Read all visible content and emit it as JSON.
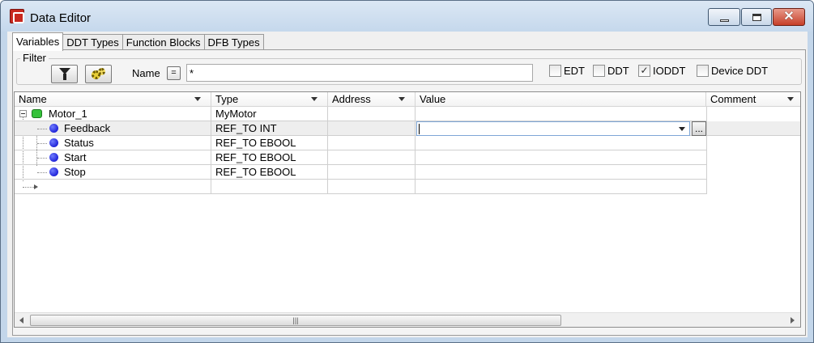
{
  "window": {
    "title": "Data Editor"
  },
  "tabs": [
    {
      "label": "Variables",
      "active": true
    },
    {
      "label": "DDT Types",
      "active": false
    },
    {
      "label": "Function Blocks",
      "active": false
    },
    {
      "label": "DFB Types",
      "active": false
    }
  ],
  "filter": {
    "group_label": "Filter",
    "name_label": "Name",
    "operator_label": "=",
    "name_value": "*",
    "checkboxes": [
      {
        "label": "EDT",
        "checked": false,
        "mark": ""
      },
      {
        "label": "DDT",
        "checked": false,
        "mark": ""
      },
      {
        "label": "IODDT",
        "checked": true,
        "mark": "✓"
      },
      {
        "label": "Device DDT",
        "checked": false,
        "mark": ""
      }
    ]
  },
  "table": {
    "columns": [
      "Name",
      "Type",
      "Address",
      "Value",
      "Comment"
    ],
    "rows": [
      {
        "name": "Motor_1",
        "type": "MyMotor",
        "address": "",
        "value": "",
        "comment": ""
      },
      {
        "name": "Feedback",
        "type": "REF_TO INT",
        "address": "",
        "value": "",
        "comment": ""
      },
      {
        "name": "Status",
        "type": "REF_TO EBOOL",
        "address": "",
        "value": "",
        "comment": ""
      },
      {
        "name": "Start",
        "type": "REF_TO EBOOL",
        "address": "",
        "value": "",
        "comment": ""
      },
      {
        "name": "Stop",
        "type": "REF_TO EBOOL",
        "address": "",
        "value": "",
        "comment": ""
      }
    ],
    "value_editor_button": "...",
    "scroll_thumb_grip": "|||"
  },
  "colors": {
    "titlebar": "#c5d8ec",
    "close_button": "#c7402a",
    "struct_icon": "#35c23a",
    "member_icon": "#0000c8",
    "selected_row": "#eeeeee"
  },
  "icons": [
    "app-logo-icon",
    "filter-funnel-icon",
    "gears-icon",
    "struct-green-icon",
    "member-dot-icon",
    "dropdown-arrow-icon"
  ]
}
